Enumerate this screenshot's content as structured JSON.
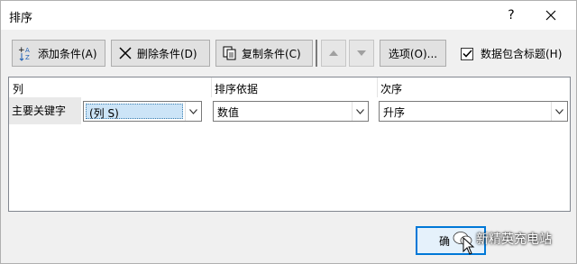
{
  "window": {
    "title": "排序",
    "help": "?"
  },
  "toolbar": {
    "add_label": "添加条件(A)",
    "delete_label": "删除条件(D)",
    "copy_label": "复制条件(C)",
    "options_label": "选项(O)...",
    "header_checkbox_label": "数据包含标题(H)",
    "header_checkbox_checked": true
  },
  "grid": {
    "headers": [
      "列",
      "排序依据",
      "次序"
    ],
    "rows": [
      {
        "label": "主要关键字",
        "column": "(列 S)",
        "basis": "数值",
        "order": "升序"
      }
    ]
  },
  "footer": {
    "ok_label": "确"
  },
  "watermark": {
    "text": "新精英充电站"
  },
  "colors": {
    "accent": "#0078d7",
    "selection": "#cce4f7"
  }
}
